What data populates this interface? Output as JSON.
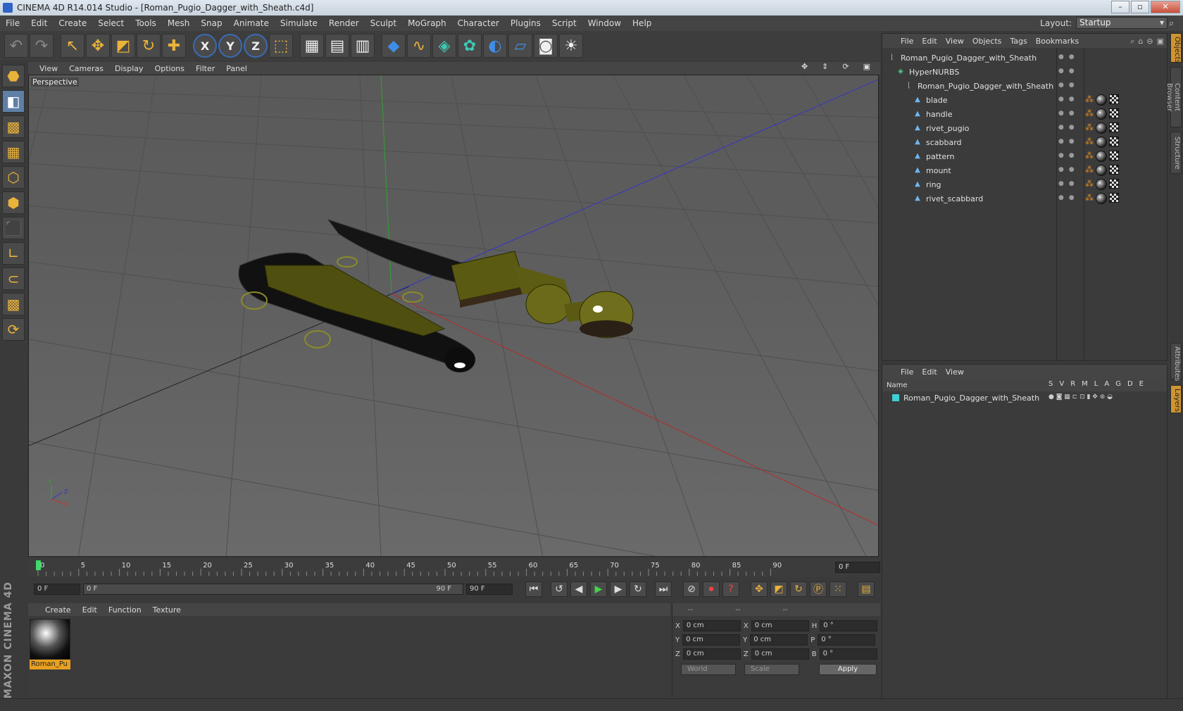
{
  "window": {
    "title": "CINEMA 4D R14.014 Studio - [Roman_Pugio_Dagger_with_Sheath.c4d]"
  },
  "menu": [
    "File",
    "Edit",
    "Create",
    "Select",
    "Tools",
    "Mesh",
    "Snap",
    "Animate",
    "Simulate",
    "Render",
    "Sculpt",
    "MoGraph",
    "Character",
    "Plugins",
    "Script",
    "Window",
    "Help"
  ],
  "layout": {
    "label": "Layout:",
    "value": "Startup"
  },
  "viewport": {
    "menu": [
      "View",
      "Cameras",
      "Display",
      "Options",
      "Filter",
      "Panel"
    ],
    "label": "Perspective"
  },
  "timeline": {
    "ticks": [
      "0",
      "5",
      "10",
      "15",
      "20",
      "25",
      "30",
      "35",
      "40",
      "45",
      "50",
      "55",
      "60",
      "65",
      "70",
      "75",
      "80",
      "85",
      "90"
    ],
    "current_frame": "0 F"
  },
  "transport": {
    "start": "0 F",
    "range_start": "0 F",
    "range_end": "90 F",
    "end": "90 F"
  },
  "materials": {
    "menu": [
      "Create",
      "Edit",
      "Function",
      "Texture"
    ],
    "items": [
      {
        "name": "Roman_Pu"
      }
    ]
  },
  "coordinates": {
    "headers": [
      "--",
      "--",
      "--"
    ],
    "rows": [
      {
        "a": "X",
        "av": "0 cm",
        "b": "X",
        "bv": "0 cm",
        "c": "H",
        "cv": "0 °"
      },
      {
        "a": "Y",
        "av": "0 cm",
        "b": "Y",
        "bv": "0 cm",
        "c": "P",
        "cv": "0 °"
      },
      {
        "a": "Z",
        "av": "0 cm",
        "b": "Z",
        "bv": "0 cm",
        "c": "B",
        "cv": "0 °"
      }
    ],
    "mode": "World",
    "scale": "Scale",
    "apply": "Apply"
  },
  "objects": {
    "menu": [
      "File",
      "Edit",
      "View",
      "Objects",
      "Tags",
      "Bookmarks"
    ],
    "tree": [
      {
        "name": "Roman_Pugio_Dagger_with_Sheath",
        "indent": 0,
        "icon": "null",
        "tags": false
      },
      {
        "name": "HyperNURBS",
        "indent": 1,
        "icon": "nurbs",
        "tags": false
      },
      {
        "name": "Roman_Pugio_Dagger_with_Sheath",
        "indent": 2,
        "icon": "null",
        "tags": false
      },
      {
        "name": "blade",
        "indent": 3,
        "icon": "poly",
        "tags": true
      },
      {
        "name": "handle",
        "indent": 3,
        "icon": "poly",
        "tags": true
      },
      {
        "name": "rivet_pugio",
        "indent": 3,
        "icon": "poly",
        "tags": true
      },
      {
        "name": "scabbard",
        "indent": 3,
        "icon": "poly",
        "tags": true
      },
      {
        "name": "pattern",
        "indent": 3,
        "icon": "poly",
        "tags": true
      },
      {
        "name": "mount",
        "indent": 3,
        "icon": "poly",
        "tags": true
      },
      {
        "name": "ring",
        "indent": 3,
        "icon": "poly",
        "tags": true
      },
      {
        "name": "rivet_scabbard",
        "indent": 3,
        "icon": "poly",
        "tags": true
      }
    ]
  },
  "layers": {
    "menu": [
      "File",
      "Edit",
      "View"
    ],
    "name_col": "Name",
    "cols": [
      "S",
      "V",
      "R",
      "M",
      "L",
      "A",
      "G",
      "D",
      "E"
    ],
    "rows": [
      {
        "name": "Roman_Pugio_Dagger_with_Sheath"
      }
    ]
  },
  "sidetabs": [
    "Objects",
    "Content Browser",
    "Structure",
    "Attributes",
    "Layers"
  ],
  "brand": "MAXON CINEMA 4D"
}
